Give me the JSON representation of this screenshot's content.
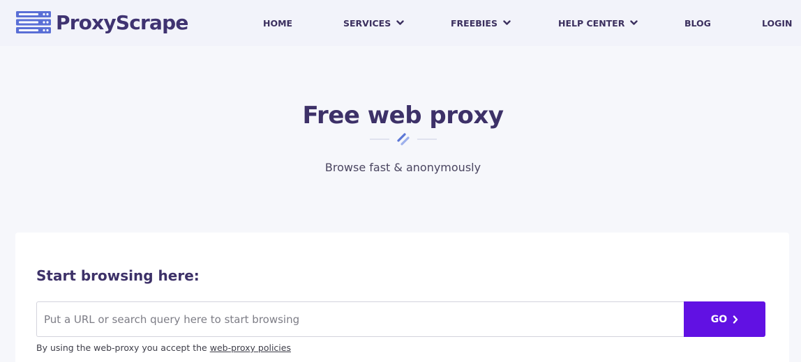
{
  "brand": {
    "name": "ProxyScrape",
    "logo_icon": "server-stack-icon",
    "color": "#3f3371",
    "icon_color": "#5a6fd6"
  },
  "nav": {
    "items": [
      {
        "label": "HOME",
        "has_dropdown": false
      },
      {
        "label": "SERVICES",
        "has_dropdown": true
      },
      {
        "label": "FREEBIES",
        "has_dropdown": true
      },
      {
        "label": "HELP CENTER",
        "has_dropdown": true
      },
      {
        "label": "BLOG",
        "has_dropdown": false
      },
      {
        "label": "LOGIN",
        "has_dropdown": false
      }
    ],
    "dropdown_icon": "chevron-down-icon"
  },
  "hero": {
    "title": "Free web proxy",
    "subtitle": "Browse fast & anonymously",
    "divider_icon": "double-slash-icon"
  },
  "browse": {
    "heading": "Start browsing here:",
    "input_value": "",
    "input_placeholder": "Put a URL or search query here to start browsing",
    "go_label": "GO",
    "go_icon": "chevron-right-icon",
    "policy_prefix": "By using the web-proxy you accept the",
    "policy_link": "web-proxy policies"
  },
  "colors": {
    "accent": "#6111e3",
    "heading": "#3d3168",
    "header_bg": "#f2f3fa",
    "page_bg": "#f6f7fb",
    "card_bg": "#ffffff"
  }
}
